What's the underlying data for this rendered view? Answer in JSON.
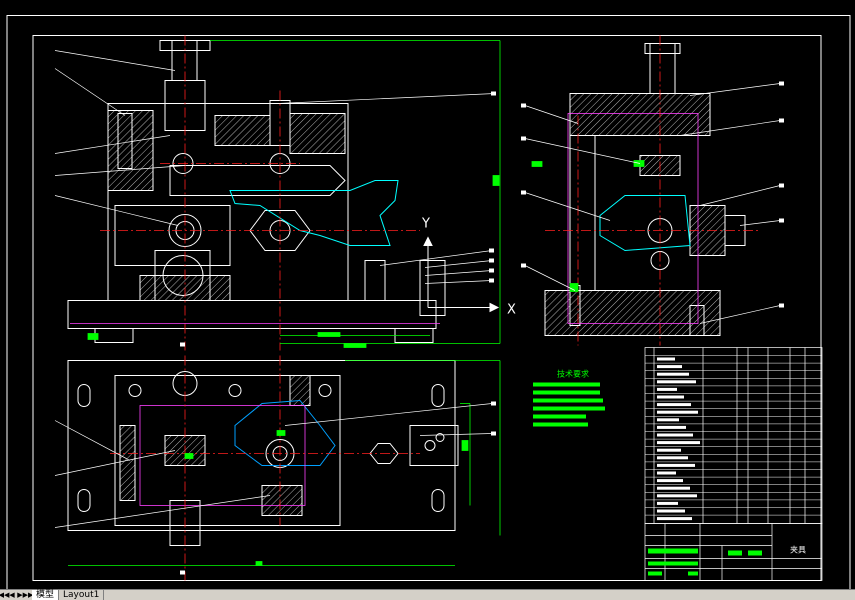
{
  "drawing": {
    "axis_label_x": "X",
    "axis_label_y": "Y",
    "tech_req_title": "技术要求",
    "title_block_name": "夹具",
    "colors": {
      "background": "#000000",
      "frame": "#ffffff",
      "centerline": "#ff2020",
      "dimension": "#00ff00",
      "hidden": "#ff40ff",
      "section": "#00a0ff",
      "outline_alt": "#00ffff",
      "hatch": "#ffffff"
    }
  },
  "tabs": {
    "nav_first": "◀◀",
    "nav_prev": "◀",
    "nav_next": "▶",
    "nav_last": "▶▶",
    "model": "模型",
    "layout1": "Layout1"
  }
}
